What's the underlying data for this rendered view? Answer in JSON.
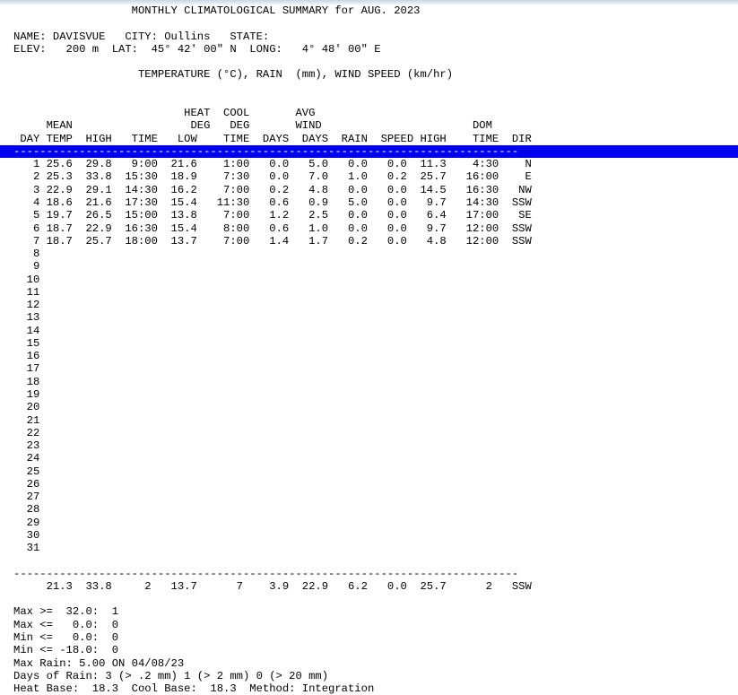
{
  "document": {
    "title": "MONTHLY CLIMATOLOGICAL SUMMARY for AUG. 2023",
    "station": {
      "name_label": "NAME:",
      "name_value": "DAVISVUE",
      "city_label": "CITY:",
      "city_value": "Oullins",
      "state_label": "STATE:",
      "state_value": "",
      "elev_label": "ELEV:",
      "elev_value": "200 m",
      "lat_label": "LAT:",
      "lat_value": "45° 42' 00\" N",
      "long_label": "LONG:",
      "long_value": "4° 48' 00\" E",
      "info_line_1": "NAME: DAVISVUE   CITY: Oullins   STATE:",
      "info_line_2": "ELEV:   200 m  LAT:  45° 42' 00\" N  LONG:   4° 48' 00\" E"
    },
    "units_line": "TEMPERATURE (°C), RAIN  (mm), WIND SPEED (km/hr)",
    "separator_selected": "-----------------------------------------------------------------------------",
    "separator_bottom": "-----------------------------------------------------------------------------",
    "header_row_1": "                          HEAT  COOL       AVG",
    "header_row_2": "     MEAN                  DEG   DEG       WIND                       DOM",
    "header_row_3": " DAY TEMP  HIGH   TIME   LOW    TIME  DAYS  DAYS  RAIN  SPEED HIGH    TIME  DIR",
    "columns": [
      "DAY",
      "MEAN TEMP",
      "HIGH",
      "TIME",
      "LOW",
      "TIME",
      "HEAT DEG DAYS",
      "COOL DEG DAYS",
      "RAIN",
      "AVG WIND SPEED",
      "HIGH",
      "TIME",
      "DOM DIR"
    ],
    "rows": [
      {
        "day": "1",
        "text": "   1 25.6  29.8   9:00  21.6    1:00   0.0   5.0   0.0   0.0  11.3    4:30    N"
      },
      {
        "day": "2",
        "text": "   2 25.3  33.8  15:30  18.9    7:30   0.0   7.0   1.0   0.2  25.7   16:00    E"
      },
      {
        "day": "3",
        "text": "   3 22.9  29.1  14:30  16.2    7:00   0.2   4.8   0.0   0.0  14.5   16:30   NW"
      },
      {
        "day": "4",
        "text": "   4 18.6  21.6  17:30  15.4   11:30   0.6   0.9   5.0   0.0   9.7   14:30  SSW"
      },
      {
        "day": "5",
        "text": "   5 19.7  26.5  15:00  13.8    7:00   1.2   2.5   0.0   0.0   6.4   17:00   SE"
      },
      {
        "day": "6",
        "text": "   6 18.7  22.9  16:30  15.4    8:00   0.6   1.0   0.0   0.0   9.7   12:00  SSW"
      },
      {
        "day": "7",
        "text": "   7 18.7  25.7  18:00  13.7    7:00   1.4   1.7   0.2   0.0   4.8   12:00  SSW"
      },
      {
        "day": "8",
        "text": "   8"
      },
      {
        "day": "9",
        "text": "   9"
      },
      {
        "day": "10",
        "text": "  10"
      },
      {
        "day": "11",
        "text": "  11"
      },
      {
        "day": "12",
        "text": "  12"
      },
      {
        "day": "13",
        "text": "  13"
      },
      {
        "day": "14",
        "text": "  14"
      },
      {
        "day": "15",
        "text": "  15"
      },
      {
        "day": "16",
        "text": "  16"
      },
      {
        "day": "17",
        "text": "  17"
      },
      {
        "day": "18",
        "text": "  18"
      },
      {
        "day": "19",
        "text": "  19"
      },
      {
        "day": "20",
        "text": "  20"
      },
      {
        "day": "21",
        "text": "  21"
      },
      {
        "day": "22",
        "text": "  22"
      },
      {
        "day": "23",
        "text": "  23"
      },
      {
        "day": "24",
        "text": "  24"
      },
      {
        "day": "25",
        "text": "  25"
      },
      {
        "day": "26",
        "text": "  26"
      },
      {
        "day": "27",
        "text": "  27"
      },
      {
        "day": "28",
        "text": "  28"
      },
      {
        "day": "29",
        "text": "  29"
      },
      {
        "day": "30",
        "text": "  30"
      },
      {
        "day": "31",
        "text": "  31"
      }
    ],
    "totals_row": "     21.3  33.8     2   13.7      7    3.9  22.9   6.2   0.0  25.7      2   SSW",
    "totals_values": {
      "mean_temp": "21.3",
      "high": "33.8",
      "high_day": "2",
      "low": "13.7",
      "low_day": "7",
      "heat_deg_days": "3.9",
      "cool_deg_days": "22.9",
      "rain": "6.2",
      "avg_wind_speed": "0.0",
      "wind_high": "25.7",
      "wind_high_day": "2",
      "dom_dir": "SSW"
    },
    "stats": {
      "max_ge": "Max >=  32.0:  1",
      "max_le": "Max <=   0.0:  0",
      "min_le": "Min <=   0.0:  0",
      "min_le_neg": "Min <= -18.0:  0",
      "max_rain": "Max Rain: 5.00 ON 04/08/23",
      "days_of_rain": "Days of Rain: 3 (> .2 mm) 1 (> 2 mm) 0 (> 20 mm)",
      "bases": "Heat Base:  18.3  Cool Base:  18.3  Method: Integration"
    }
  },
  "colors": {
    "selection_blue": "#0000ee",
    "selection_text": "#ffffff",
    "page_background": "#ffffff",
    "text": "#000000",
    "chrome_bar": "#c8d6e0"
  }
}
